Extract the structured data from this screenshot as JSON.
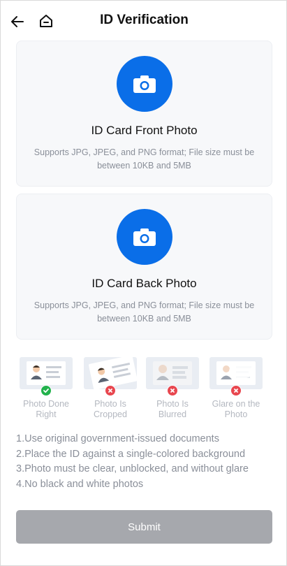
{
  "header": {
    "title": "ID Verification",
    "back_icon": "arrow-left-icon",
    "home_icon": "home-icon"
  },
  "cards": [
    {
      "title": "ID Card Front Photo",
      "description": "Supports JPG, JPEG, and PNG format; File size must be between 10KB and 5MB",
      "icon": "camera-icon"
    },
    {
      "title": "ID Card Back Photo",
      "description": "Supports JPG, JPEG, and PNG format; File size must be between 10KB and 5MB",
      "icon": "camera-icon"
    }
  ],
  "examples": [
    {
      "label": "Photo Done Right",
      "status": "check-icon"
    },
    {
      "label": "Photo Is Cropped",
      "status": "cross-icon"
    },
    {
      "label": "Photo Is Blurred",
      "status": "cross-icon"
    },
    {
      "label": "Glare on the Photo",
      "status": "cross-icon"
    }
  ],
  "tips": [
    "1.Use original government-issued documents",
    "2.Place the ID against a single-colored background",
    "3.Photo must be clear, unblocked, and without glare",
    "4.No black and white photos"
  ],
  "submit_label": "Submit",
  "colors": {
    "accent": "#0a6ee8",
    "ok": "#22b24c",
    "error": "#e8474f",
    "disabled": "#a6a8ad"
  }
}
